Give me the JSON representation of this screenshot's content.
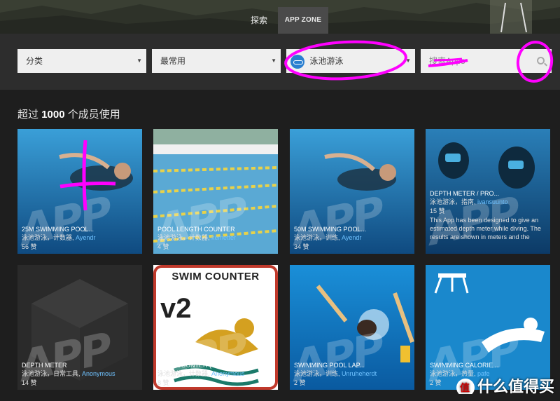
{
  "nav": {
    "tabs": [
      {
        "label": "探索"
      },
      {
        "label": "APP ZONE"
      }
    ]
  },
  "filters": {
    "category": "分类",
    "sort": "最常用",
    "activity": "泳池游泳",
    "search_placeholder": "搜索Apps"
  },
  "section": {
    "heading_prefix": "超过",
    "heading_count": "1000",
    "heading_suffix": "个成员使用"
  },
  "apps": [
    {
      "title": "25M SWIMMING POOL...",
      "tags": "泳池游泳，计数器,",
      "author": "Ayendr",
      "likes": "56 赞"
    },
    {
      "title": "POOL LENGTH COUNTER",
      "tags": "泳池游泳，计数器,",
      "author": "kemetter",
      "likes": "4 赞"
    },
    {
      "title": "50M SWIMMING POOL...",
      "tags": "泳池游泳，训练,",
      "author": "Ayendr",
      "likes": "34 赞"
    },
    {
      "title": "DEPTH METER / PRO...",
      "tags": "泳池游泳，指南,",
      "author": "ivansuunto",
      "likes": "15 赞",
      "description": "This App has been designed to give an estimated depth meter while diving. The results are shown in meters and the"
    },
    {
      "title": "DEPTH METER",
      "tags": "泳池游泳，日常工具,",
      "author": "Anonymous",
      "likes": "14 赞"
    },
    {
      "title": "SWIM COUNTER (V2)",
      "tags": "泳池游泳，计数器,",
      "author": "Anonymous",
      "likes": "8 赞"
    },
    {
      "title": "SWIMMING POOL LAP...",
      "tags": "泳池游泳，训练,",
      "author": "Unruheherdt",
      "likes": "2 赞"
    },
    {
      "title": "SWIMMING CALORIE ...",
      "tags": "泳池游泳，热量,",
      "author": "pafe",
      "likes": "2 赞"
    }
  ],
  "swim_counter_tile": {
    "title": "SWIM COUNTER",
    "version": "v2"
  },
  "watermark": {
    "text": "什么值得买"
  },
  "card_watermark": "APP"
}
